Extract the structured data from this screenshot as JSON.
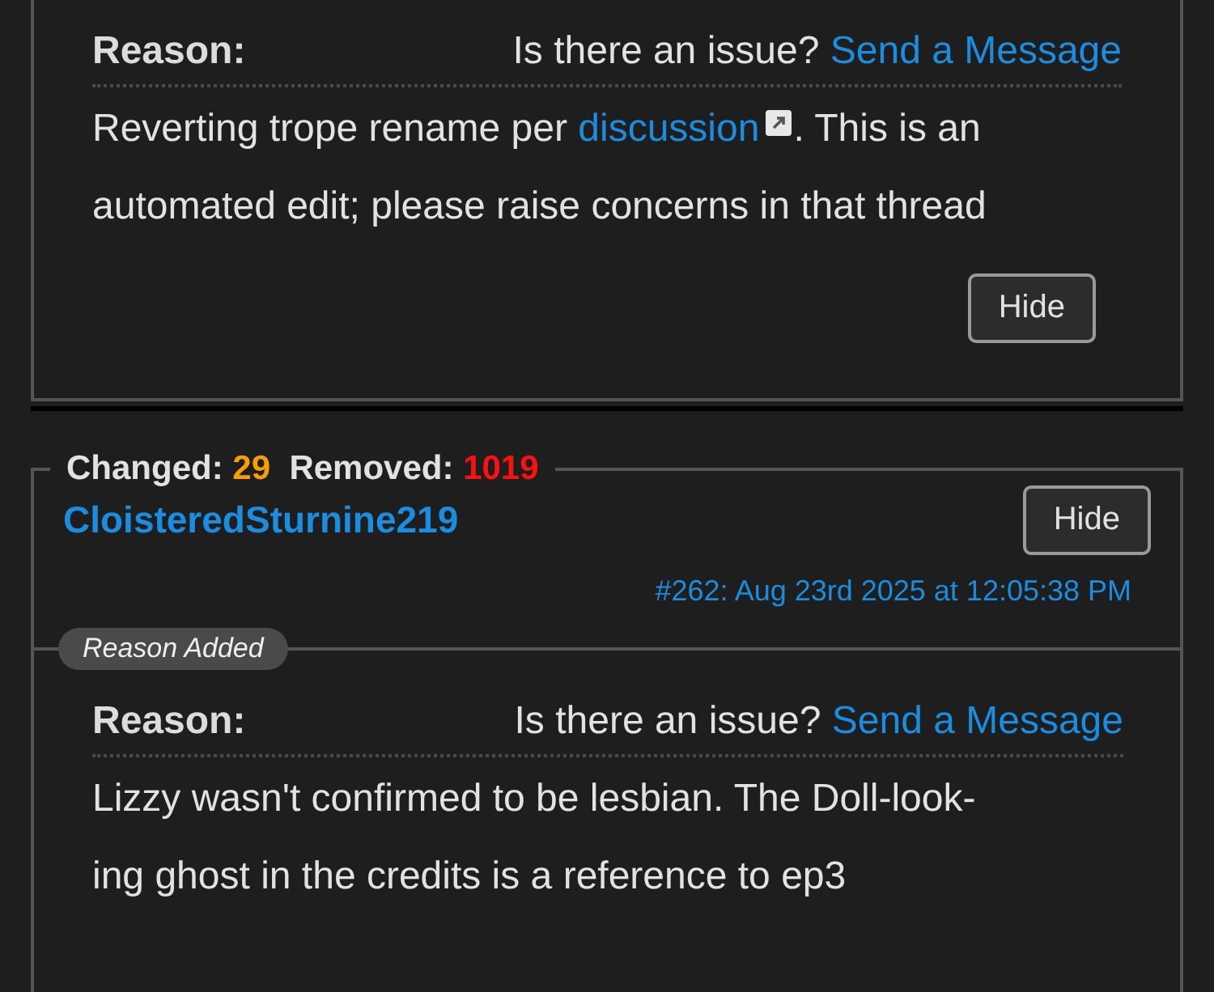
{
  "top_reason": {
    "label": "Reason:",
    "issue_text": "Is there an issue?",
    "message_link": "Send a Message",
    "body": {
      "before": "Reverting trope rename per ",
      "link": "discussion",
      "after": ". This is an automated edit; please raise concerns in that thread"
    },
    "hide_button": "Hide"
  },
  "edit": {
    "changed_label": "Changed:",
    "changed_count": "29",
    "removed_label": "Removed:",
    "removed_count": "1019",
    "user": "CloisteredSturnine219",
    "hide_button": "Hide",
    "timestamp": "#262: Aug 23rd 2025 at 12:05:38 PM",
    "badge": "Reason Added",
    "reason": {
      "label": "Reason:",
      "issue_text": "Is there an issue?",
      "message_link": "Send a Message",
      "body": "Lizzy wasn't confirmed to be lesbian. The Doll-look-\ning ghost in the credits is a reference to ep3"
    }
  }
}
